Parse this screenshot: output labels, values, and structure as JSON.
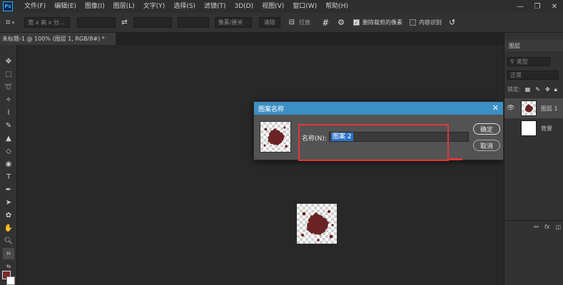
{
  "app": {
    "logo": "Ps"
  },
  "menu": [
    "文件(F)",
    "编辑(E)",
    "图像(I)",
    "图层(L)",
    "文字(Y)",
    "选择(S)",
    "滤镜(T)",
    "3D(D)",
    "视图(V)",
    "窗口(W)",
    "帮助(H)"
  ],
  "window_buttons": {
    "minimize": "—",
    "restore": "❐",
    "close": "✕"
  },
  "options": {
    "ratio_placeholder": "宽 x 高 x 分...",
    "units_box": "像素/厘米",
    "clear_label": "清除",
    "straighten_label": "拉直",
    "delete_cropped_label": "删除裁剪的像素",
    "delete_cropped_checked": true,
    "content_aware_label": "内容识别",
    "content_aware_checked": false
  },
  "document_tab": "未标题-1 @ 100% (图层 1, RGB/8#) *",
  "dialog": {
    "title": "图案名称",
    "name_label": "名称(N):",
    "name_value": "图案 2",
    "ok_label": "确定",
    "cancel_label": "取消"
  },
  "layers_panel": {
    "title": "图层",
    "filter_kind": "类型",
    "blend_mode": "正常",
    "lock_label": "锁定:",
    "layers": [
      {
        "name": "图层 1",
        "visible": true,
        "selected": true
      },
      {
        "name": "背景",
        "visible": false,
        "selected": false
      }
    ]
  },
  "colors": {
    "foreground": "#7a2a2a",
    "background": "#ffffff",
    "accent": "#3c8fc4",
    "highlight": "#e0363a",
    "splat": "#6b2424"
  }
}
